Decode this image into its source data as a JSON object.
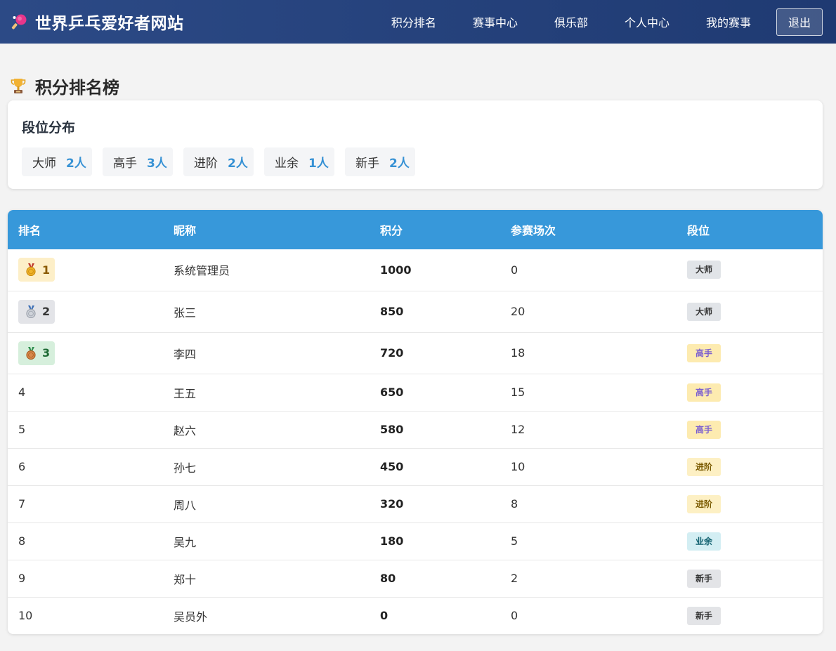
{
  "header": {
    "site_title": "世界乒乓爱好者网站",
    "nav": [
      "积分排名",
      "赛事中心",
      "俱乐部",
      "个人中心",
      "我的赛事"
    ],
    "logout_label": "退出"
  },
  "page_title": "积分排名榜",
  "distribution": {
    "title": "段位分布",
    "items": [
      {
        "label": "大师",
        "count": "2人"
      },
      {
        "label": "高手",
        "count": "3人"
      },
      {
        "label": "进阶",
        "count": "2人"
      },
      {
        "label": "业余",
        "count": "1人"
      },
      {
        "label": "新手",
        "count": "2人"
      }
    ]
  },
  "table": {
    "headers": [
      "排名",
      "昵称",
      "积分",
      "参赛场次",
      "段位"
    ],
    "rows": [
      {
        "rank": "1",
        "medal": "gold",
        "name": "系统管理员",
        "points": "1000",
        "matches": "0",
        "level": "大师",
        "level_style": "master"
      },
      {
        "rank": "2",
        "medal": "silver",
        "name": "张三",
        "points": "850",
        "matches": "20",
        "level": "大师",
        "level_style": "master"
      },
      {
        "rank": "3",
        "medal": "bronze",
        "name": "李四",
        "points": "720",
        "matches": "18",
        "level": "高手",
        "level_style": "expert"
      },
      {
        "rank": "4",
        "medal": "",
        "name": "王五",
        "points": "650",
        "matches": "15",
        "level": "高手",
        "level_style": "expert"
      },
      {
        "rank": "5",
        "medal": "",
        "name": "赵六",
        "points": "580",
        "matches": "12",
        "level": "高手",
        "level_style": "expert"
      },
      {
        "rank": "6",
        "medal": "",
        "name": "孙七",
        "points": "450",
        "matches": "10",
        "level": "进阶",
        "level_style": "advanced"
      },
      {
        "rank": "7",
        "medal": "",
        "name": "周八",
        "points": "320",
        "matches": "8",
        "level": "进阶",
        "level_style": "advanced"
      },
      {
        "rank": "8",
        "medal": "",
        "name": "吴九",
        "points": "180",
        "matches": "5",
        "level": "业余",
        "level_style": "amateur"
      },
      {
        "rank": "9",
        "medal": "",
        "name": "郑十",
        "points": "80",
        "matches": "2",
        "level": "新手",
        "level_style": "novice"
      },
      {
        "rank": "10",
        "medal": "",
        "name": "吴员外",
        "points": "0",
        "matches": "0",
        "level": "新手",
        "level_style": "novice"
      }
    ]
  },
  "colors": {
    "header_bg": "#23427c",
    "table_header_bg": "#3798da",
    "accent": "#3691d4",
    "level_styles": {
      "master": {
        "bg": "#e1e4e8",
        "fg": "#333333"
      },
      "expert": {
        "bg": "#fdebb0",
        "fg": "#7b5fd0"
      },
      "advanced": {
        "bg": "#fdf0c4",
        "fg": "#7a5a00"
      },
      "amateur": {
        "bg": "#d3eef3",
        "fg": "#0f5f6e"
      },
      "novice": {
        "bg": "#e3e4e7",
        "fg": "#333333"
      }
    }
  },
  "icons": {
    "brand": "ping-pong-paddle-icon",
    "title": "trophy-icon",
    "medals": [
      "gold-medal-icon",
      "silver-medal-icon",
      "bronze-medal-icon"
    ]
  }
}
